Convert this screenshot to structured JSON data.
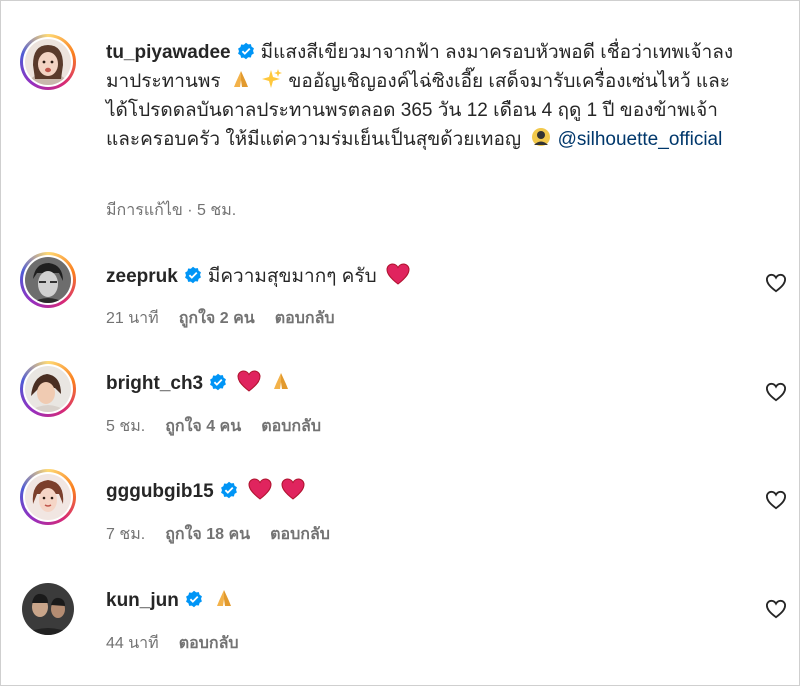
{
  "comments": [
    {
      "username": "tu_piyawadee",
      "text_parts": [
        "มีแสงสีเขียวมาจากฟ้า ลงมาครอบหัวพอดี เชื่อว่าเทพเจ้าลงมาประทานพร",
        "ขออัญเชิญองค์ไฉ่ซิงเอี๊ย เสด็จมารับเครื่องเซ่นไหว้ และได้โปรดดลบันดาลประทานพรตลอด 365 วัน 12 เดือน 4 ฤดู 1 ปี ของข้าพเจ้าและครอบครัว ให้มีแต่ความร่มเย็นเป็นสุขด้วยเทอญ"
      ],
      "mention": "@silhouette_official",
      "edited": "มีการแก้ไข",
      "time": "5 ชม.",
      "meta_line": "มีการแก้ไข · 5 ชม."
    },
    {
      "username": "zeepruk",
      "text": "มีความสุขมากๆ ครับ",
      "time": "21 นาที",
      "likes": "ถูกใจ 2 คน",
      "reply": "ตอบกลับ"
    },
    {
      "username": "bright_ch3",
      "text": "",
      "time": "5 ชม.",
      "likes": "ถูกใจ 4 คน",
      "reply": "ตอบกลับ"
    },
    {
      "username": "gggubgib15",
      "text": "",
      "time": "7 ชม.",
      "likes": "ถูกใจ 18 คน",
      "reply": "ตอบกลับ"
    },
    {
      "username": "kun_jun",
      "text": "",
      "time": "44 นาที",
      "reply": "ตอบกลับ"
    }
  ],
  "icons": {
    "verified": "verified-badge-icon",
    "like": "heart-outline-icon",
    "emoji_pray": "folded-hands-emoji",
    "emoji_sparkles": "sparkles-emoji",
    "emoji_heart": "red-heart-emoji",
    "emoji_god": "deity-emoji"
  },
  "colors": {
    "verified": "#0095f6",
    "mention": "#00376b",
    "heart": "#e0245e",
    "meta": "#737373"
  }
}
